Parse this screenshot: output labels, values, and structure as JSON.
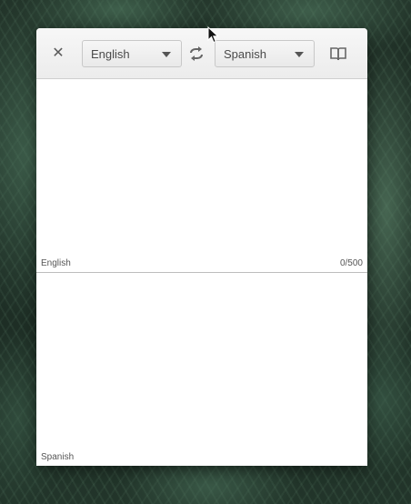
{
  "window": {
    "close_icon": "close-icon",
    "source_language": "English",
    "target_language": "Spanish",
    "swap_icon": "swap-icon",
    "dictionary_icon": "book-icon"
  },
  "source_pane": {
    "text": "",
    "language_label": "English",
    "char_count": "0/500"
  },
  "target_pane": {
    "text": "",
    "language_label": "Spanish"
  },
  "colors": {
    "header_bg": "#ececec",
    "pane_bg": "#ffffff",
    "label_text": "#555555"
  }
}
